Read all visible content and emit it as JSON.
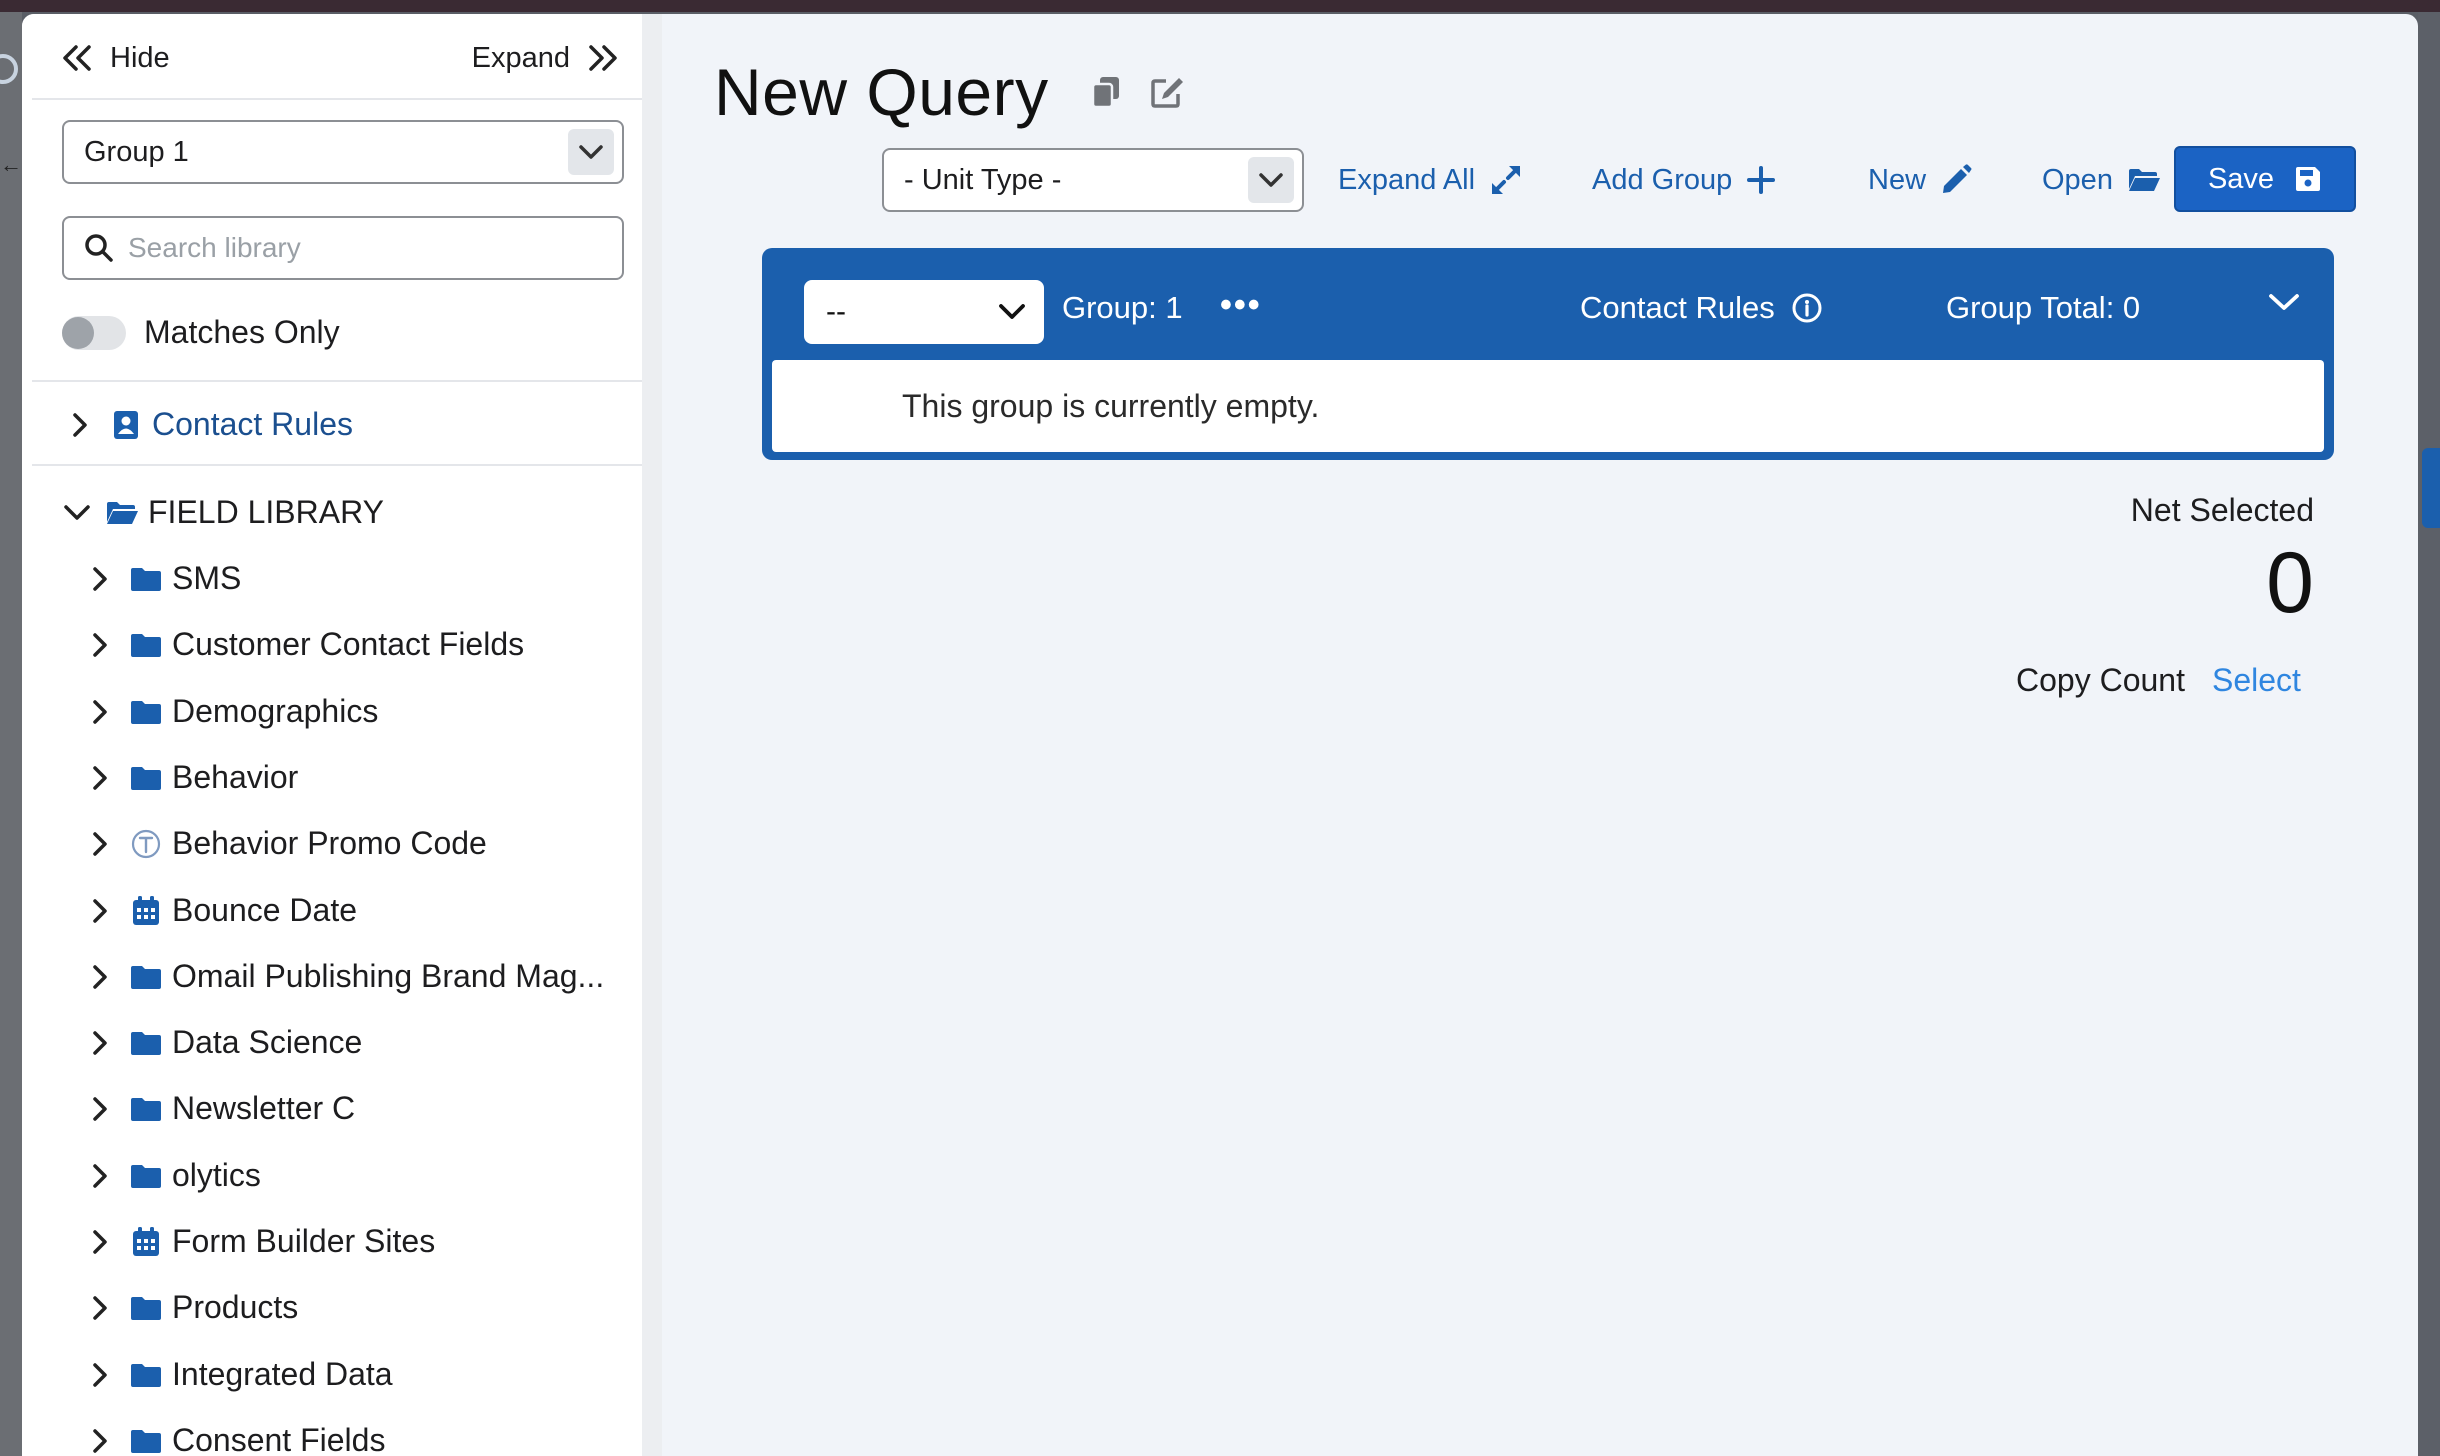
{
  "sidebar": {
    "hide_label": "Hide",
    "expand_label": "Expand",
    "group_select_value": "Group 1",
    "search_placeholder": "Search library",
    "matches_only_label": "Matches Only",
    "contact_rules_label": "Contact Rules",
    "field_library_label": "FIELD LIBRARY",
    "items": [
      {
        "label": "SMS",
        "icon": "folder-icon"
      },
      {
        "label": "Customer Contact Fields",
        "icon": "folder-icon"
      },
      {
        "label": "Demographics",
        "icon": "folder-icon"
      },
      {
        "label": "Behavior",
        "icon": "folder-icon"
      },
      {
        "label": "Behavior Promo Code",
        "icon": "text-field-icon"
      },
      {
        "label": "Bounce Date",
        "icon": "calendar-icon"
      },
      {
        "label": "Omail Publishing Brand Mag...",
        "icon": "folder-icon"
      },
      {
        "label": "Data Science",
        "icon": "folder-icon"
      },
      {
        "label": "Newsletter C",
        "icon": "folder-icon"
      },
      {
        "label": "olytics",
        "icon": "folder-icon"
      },
      {
        "label": "Form Builder Sites",
        "icon": "calendar-icon"
      },
      {
        "label": "Products",
        "icon": "folder-icon"
      },
      {
        "label": "Integrated Data",
        "icon": "folder-icon"
      },
      {
        "label": "Consent Fields",
        "icon": "folder-icon"
      }
    ]
  },
  "main": {
    "title": "New Query",
    "unit_type_value": "- Unit Type -",
    "expand_all_label": "Expand All",
    "add_group_label": "Add Group",
    "new_label": "New",
    "open_label": "Open",
    "save_label": "Save",
    "group": {
      "select_value": "--",
      "label": "Group: 1",
      "contact_rules_label": "Contact Rules",
      "total_label": "Group Total: 0",
      "empty_message": "This group is currently empty."
    },
    "net_selected_label": "Net Selected",
    "net_selected_value": "0",
    "copy_count_label": "Copy Count",
    "copy_count_link": "Select"
  },
  "colors": {
    "accent": "#1b5fad",
    "link": "#2f86e0",
    "save": "#1b63c4"
  }
}
